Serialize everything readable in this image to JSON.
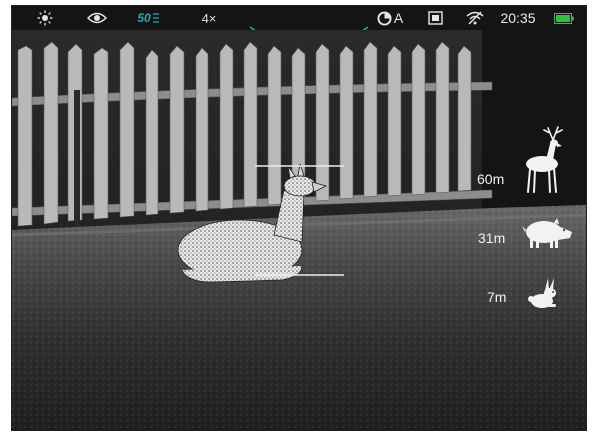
{
  "status_bar": {
    "zoom": "4×",
    "refresh_rate": "50",
    "calibration_mode": "A",
    "time": "20:35",
    "accent_color": "#2aa7b8",
    "battery_color": "#2fc13f",
    "icons": [
      "brightness-icon",
      "eye-icon",
      "refresh-rate-icon",
      "calibration-icon",
      "video-record-icon",
      "wifi-off-icon",
      "battery-icon"
    ]
  },
  "rangefinder": {
    "items": [
      {
        "distance": "60m",
        "animal": "deer-icon"
      },
      {
        "distance": "31m",
        "animal": "boar-icon"
      },
      {
        "distance": "7m",
        "animal": "rabbit-icon"
      }
    ]
  }
}
